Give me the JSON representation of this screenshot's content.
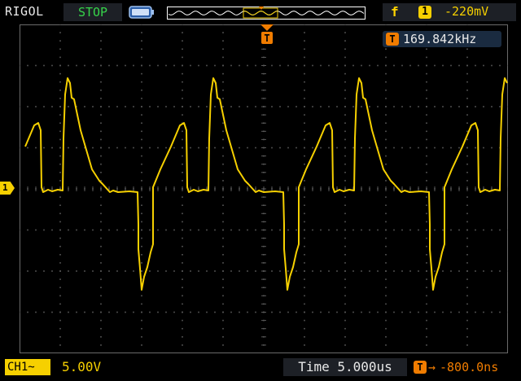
{
  "header": {
    "brand": "RIGOL",
    "run_state": "STOP",
    "trigger": {
      "edge_symbol": "f",
      "source_channel": "1",
      "level": "-220mV"
    }
  },
  "measurement": {
    "marker": "T",
    "frequency": "169.842kHz"
  },
  "channel_marker": "1",
  "trigger_position_marker": "T",
  "footer": {
    "channel_label": "CH1",
    "coupling_symbol": "~",
    "volts_per_div": "5.00V",
    "timebase": "Time 5.000us",
    "offset_marker": "T",
    "offset_arrow": "→",
    "trigger_offset": "-800.0ns"
  },
  "colors": {
    "trace": "#f6d000",
    "grid": "#5a5a5a",
    "accent": "#f07c00",
    "stop": "#36d44a"
  }
}
